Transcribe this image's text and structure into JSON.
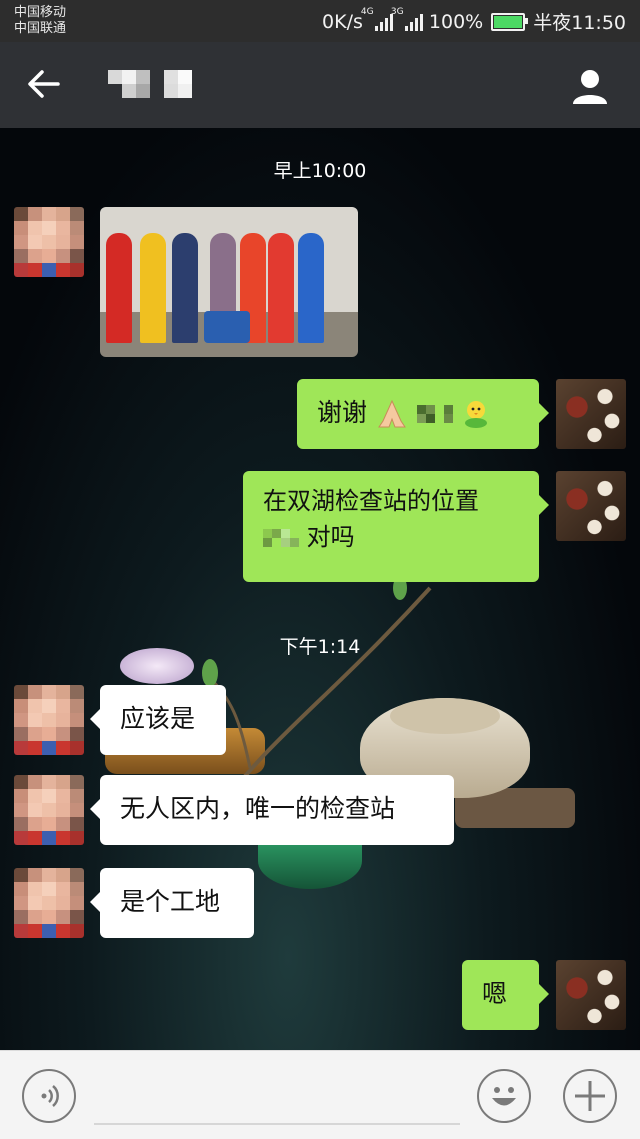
{
  "status_bar": {
    "carrier1": "中国移动",
    "carrier2": "中国联通",
    "speed": "0K/s",
    "network1": "4G",
    "network2": "3G",
    "battery": "100%",
    "time": "半夜11:50"
  },
  "header": {
    "back_icon": "arrow-left-icon",
    "contact_icon": "person-icon"
  },
  "messages": {
    "time1": "早上10:00",
    "msg_thanks": "谢谢",
    "msg_location_a": "在双湖检查站的位置",
    "msg_location_b": "对吗",
    "time2": "下午1:14",
    "msg_should_be": "应该是",
    "msg_checkpoint": "无人区内，唯一的检查站",
    "msg_site": "是个工地",
    "msg_en": "嗯"
  },
  "colors": {
    "outgoing_bubble": "#9fe658",
    "incoming_bubble": "#ffffff",
    "titlebar": "#2f3135"
  }
}
